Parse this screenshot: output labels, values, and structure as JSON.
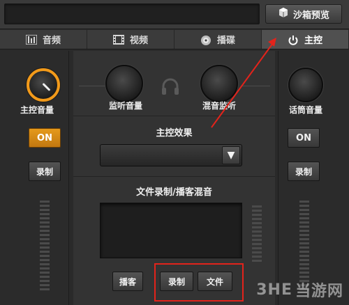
{
  "top": {
    "sandbox_label": "沙箱预览"
  },
  "tabs": [
    {
      "label": "音频",
      "icon": "equalizer-icon"
    },
    {
      "label": "视频",
      "icon": "film-icon"
    },
    {
      "label": "播碟",
      "icon": "disc-icon"
    },
    {
      "label": "主控",
      "icon": "power-icon",
      "active": true
    }
  ],
  "left": {
    "knob_label": "主控音量",
    "on_label": "ON",
    "record_label": "录制"
  },
  "center": {
    "monitor_label": "监听音量",
    "mix_label": "混音监听",
    "effects_title": "主控效果",
    "dropdown_arrow": "▼",
    "recording_title": "文件录制/播客混音",
    "podcast_label": "播客",
    "record_label": "录制",
    "file_label": "文件"
  },
  "right": {
    "knob_label": "话筒音量",
    "on_label": "ON",
    "record_label": "录制"
  },
  "colors": {
    "accent": "#f29a1a",
    "annotation": "#e3231b"
  },
  "watermark": {
    "brand": "3HE",
    "site": "当游网"
  }
}
